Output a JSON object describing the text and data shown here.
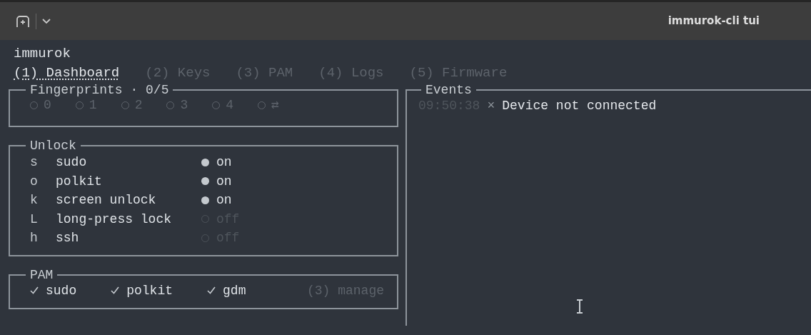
{
  "window": {
    "title": "immurok-cli tui"
  },
  "app_name": "immurok",
  "tabs": [
    {
      "label": "(1) Dashboard",
      "selected": true
    },
    {
      "label": "(2) Keys",
      "selected": false
    },
    {
      "label": "(3) PAM",
      "selected": false
    },
    {
      "label": "(4) Logs",
      "selected": false
    },
    {
      "label": "(5) Firmware",
      "selected": false
    }
  ],
  "fingerprints": {
    "title": "Fingerprints · 0/5",
    "slots": [
      {
        "label": "0",
        "enrolled": false
      },
      {
        "label": "1",
        "enrolled": false
      },
      {
        "label": "2",
        "enrolled": false
      },
      {
        "label": "3",
        "enrolled": false
      },
      {
        "label": "4",
        "enrolled": false
      },
      {
        "label": "⇄",
        "enrolled": false
      }
    ]
  },
  "unlock": {
    "title": "Unlock",
    "items": [
      {
        "key": "s",
        "label": "sudo",
        "on": true,
        "state": "on"
      },
      {
        "key": "o",
        "label": "polkit",
        "on": true,
        "state": "on"
      },
      {
        "key": "k",
        "label": "screen unlock",
        "on": true,
        "state": "on"
      },
      {
        "key": "L",
        "label": "long-press lock",
        "on": false,
        "state": "off"
      },
      {
        "key": "h",
        "label": "ssh",
        "on": false,
        "state": "off"
      }
    ]
  },
  "pam": {
    "title": "PAM",
    "items": [
      {
        "label": "sudo",
        "checked": true
      },
      {
        "label": "polkit",
        "checked": true
      },
      {
        "label": "gdm",
        "checked": true
      }
    ],
    "hint": "(3) manage"
  },
  "events": {
    "title": "Events",
    "items": [
      {
        "time": "09:50:38",
        "icon": "×",
        "message": "Device not connected"
      }
    ]
  }
}
